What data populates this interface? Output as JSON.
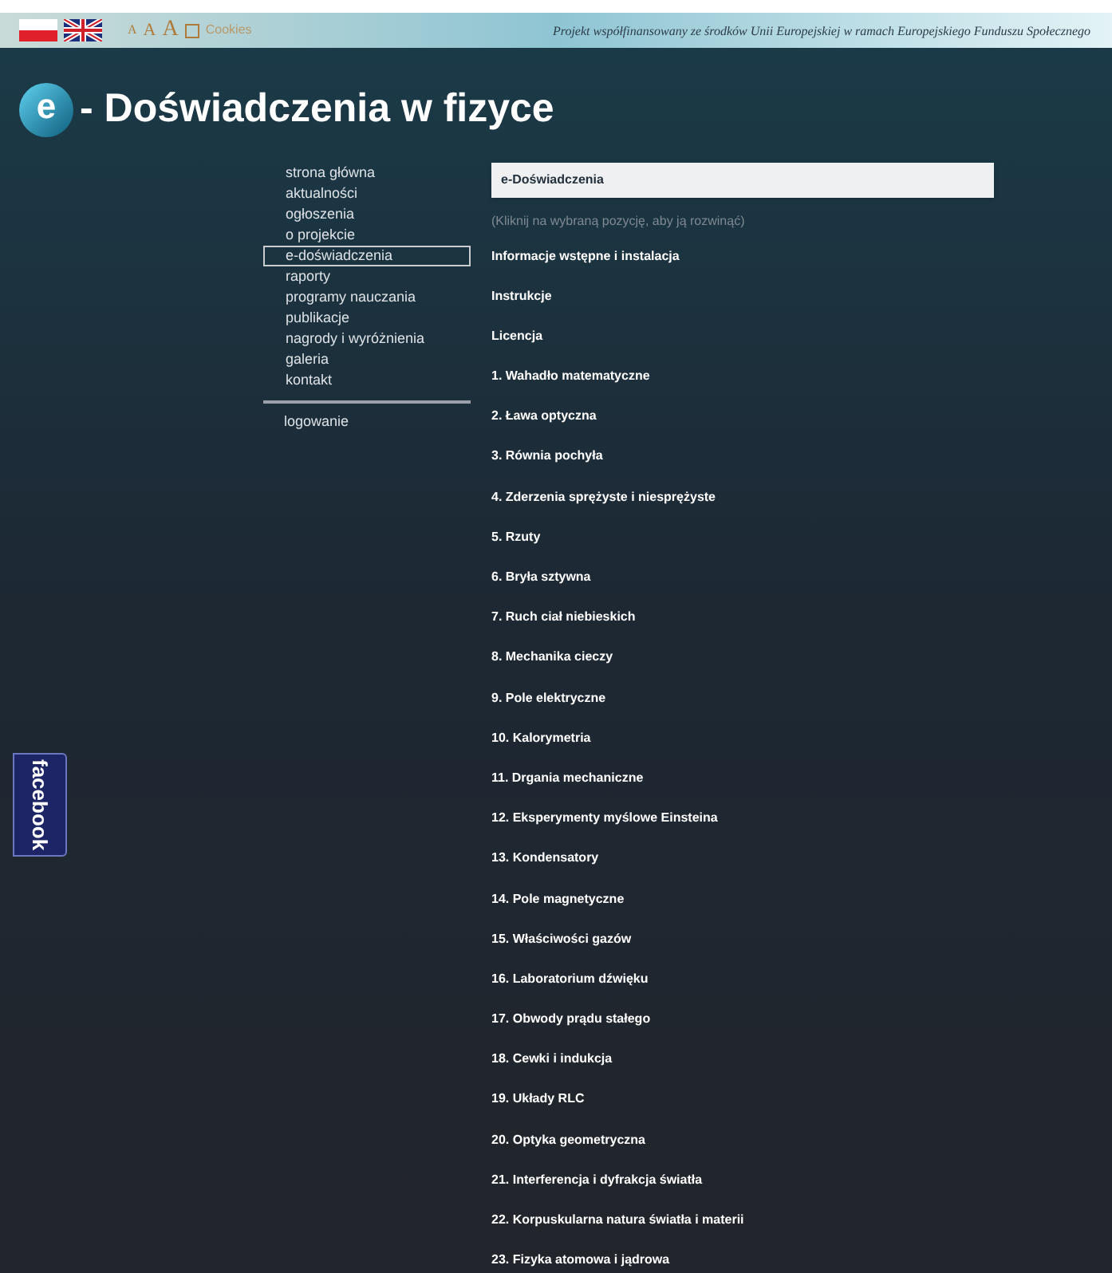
{
  "top_bar": {
    "font_sizes": [
      "A",
      "A",
      "A"
    ],
    "cookies": "Cookies",
    "project_note": "Projekt współfinansowany ze środków Unii Europejskiej w ramach Europejskiego Funduszu Społecznego"
  },
  "logo": {
    "letter": "e",
    "title": "- Doświadczenia w fizyce"
  },
  "nav": {
    "items": [
      {
        "label": "strona główna",
        "selected": false
      },
      {
        "label": "aktualności",
        "selected": false
      },
      {
        "label": "ogłoszenia",
        "selected": false
      },
      {
        "label": "o projekcie",
        "selected": false
      },
      {
        "label": "e-doświadczenia",
        "selected": true
      },
      {
        "label": "raporty",
        "selected": false
      },
      {
        "label": "programy nauczania",
        "selected": false
      },
      {
        "label": "publikacje",
        "selected": false
      },
      {
        "label": "nagrody i wyróżnienia",
        "selected": false
      },
      {
        "label": "galeria",
        "selected": false
      },
      {
        "label": "kontakt",
        "selected": false
      }
    ],
    "login": "logowanie"
  },
  "content": {
    "heading": "e-Doświadczenia",
    "hint": "(Kliknij na wybraną pozycję, aby ją rozwinąć)",
    "items": [
      "Informacje wstępne i instalacja",
      "Instrukcje",
      "Licencja",
      "1. Wahadło matematyczne",
      "2. Ława optyczna",
      "3. Równia pochyła",
      "4. Zderzenia sprężyste i niesprężyste",
      "5. Rzuty",
      "6. Bryła sztywna",
      "7. Ruch ciał niebieskich",
      "8. Mechanika cieczy",
      "9. Pole elektryczne",
      "10. Kalorymetria",
      "11. Drgania mechaniczne",
      "12. Eksperymenty myślowe Einsteina",
      "13. Kondensatory",
      "14. Pole magnetyczne",
      "15. Właściwości gazów",
      "16. Laboratorium dźwięku",
      "17. Obwody prądu stałego",
      "18. Cewki i indukcja",
      "19. Układy RLC",
      "20. Optyka geometryczna",
      "21. Interferencja i dyfrakcja światła",
      "22. Korpuskularna natura światła i materii",
      "23. Fizyka atomowa i jądrowa"
    ]
  },
  "facebook_tab": "facebook"
}
